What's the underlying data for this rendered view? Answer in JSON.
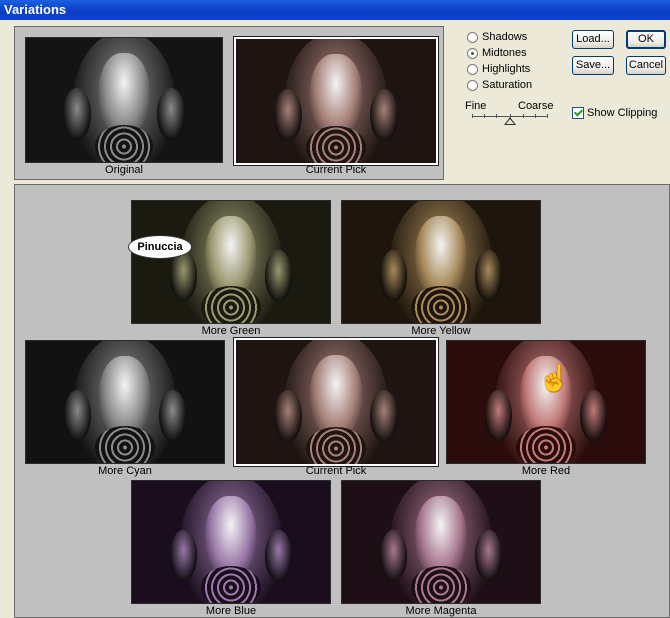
{
  "window": {
    "title": "Variations"
  },
  "preview": {
    "original": {
      "caption": "Original",
      "tint": "#8a8a8a",
      "bg": "#141414"
    },
    "current": {
      "caption": "Current Pick",
      "tint": "#a68078",
      "bg": "#1e1412"
    }
  },
  "options": {
    "items": [
      {
        "label": "Shadows",
        "checked": false
      },
      {
        "label": "Midtones",
        "checked": true
      },
      {
        "label": "Highlights",
        "checked": false
      },
      {
        "label": "Saturation",
        "checked": false
      }
    ],
    "fine_label": "Fine",
    "coarse_label": "Coarse",
    "show_clipping_label": "Show Clipping",
    "show_clipping_checked": true
  },
  "buttons": {
    "load": "Load...",
    "ok": "OK",
    "save": "Save...",
    "cancel": "Cancel"
  },
  "variations": [
    {
      "caption": "More Green",
      "tint": "#9a9870",
      "bg": "#1a1a10"
    },
    {
      "caption": "More Yellow",
      "tint": "#a88a5a",
      "bg": "#1e160c"
    },
    {
      "caption": "More Cyan",
      "tint": "#8a8a8a",
      "bg": "#121212"
    },
    {
      "caption": "Current Pick",
      "tint": "#a68078",
      "bg": "#1e1412"
    },
    {
      "caption": "More Red",
      "tint": "#c07a78",
      "bg": "#2a0c0c"
    },
    {
      "caption": "More Blue",
      "tint": "#9a78a8",
      "bg": "#1a0e1e"
    },
    {
      "caption": "More Magenta",
      "tint": "#a87890",
      "bg": "#1e0e16"
    }
  ],
  "watermark": {
    "text": "Pinuccia"
  },
  "cursor": {
    "icon": "hand-pointer-icon"
  }
}
